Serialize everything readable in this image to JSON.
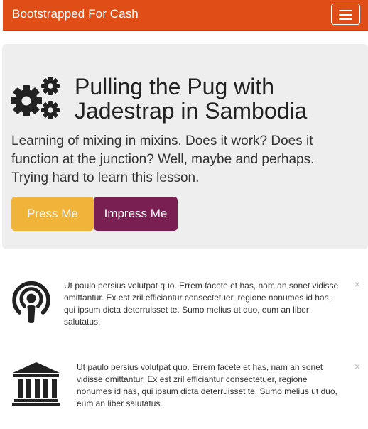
{
  "navbar": {
    "brand": "Bootstrapped For Cash",
    "toggle_icon": "hamburger-menu-icon",
    "background_color": "#e04d16"
  },
  "jumbotron": {
    "icon": "gears-icon",
    "title": "Pulling the Pug with Jadestrap in Sambodia",
    "lead": "Learning of mixing in mixins. Does it work? Does it function at the junction? Well, maybe and perhaps. Trying hard to learn this lesson.",
    "buttons": [
      {
        "label": "Press Me",
        "color": "#f0b43a"
      },
      {
        "label": "Impress Me",
        "color": "#7a1f52"
      }
    ]
  },
  "media_items": [
    {
      "icon": "podcast-icon",
      "text": "Ut paulo persius volutpat quo. Errem facete et has, nam an sonet vidisse omittantur. Ex est zril efficiantur consectetuer, regione nonumes id has, qui ipsum dicta deterruisset te. Sumo melius ut duo, eum an liber salutatus.",
      "close": "×"
    },
    {
      "icon": "bank-icon",
      "text": "Ut paulo persius volutpat quo. Errem facete et has, nam an sonet vidisse omittantur. Ex est zril efficiantur consectetuer, regione nonumes id has, qui ipsum dicta deterruisset te. Sumo melius ut duo, eum an liber salutatus.",
      "close": "×"
    }
  ]
}
